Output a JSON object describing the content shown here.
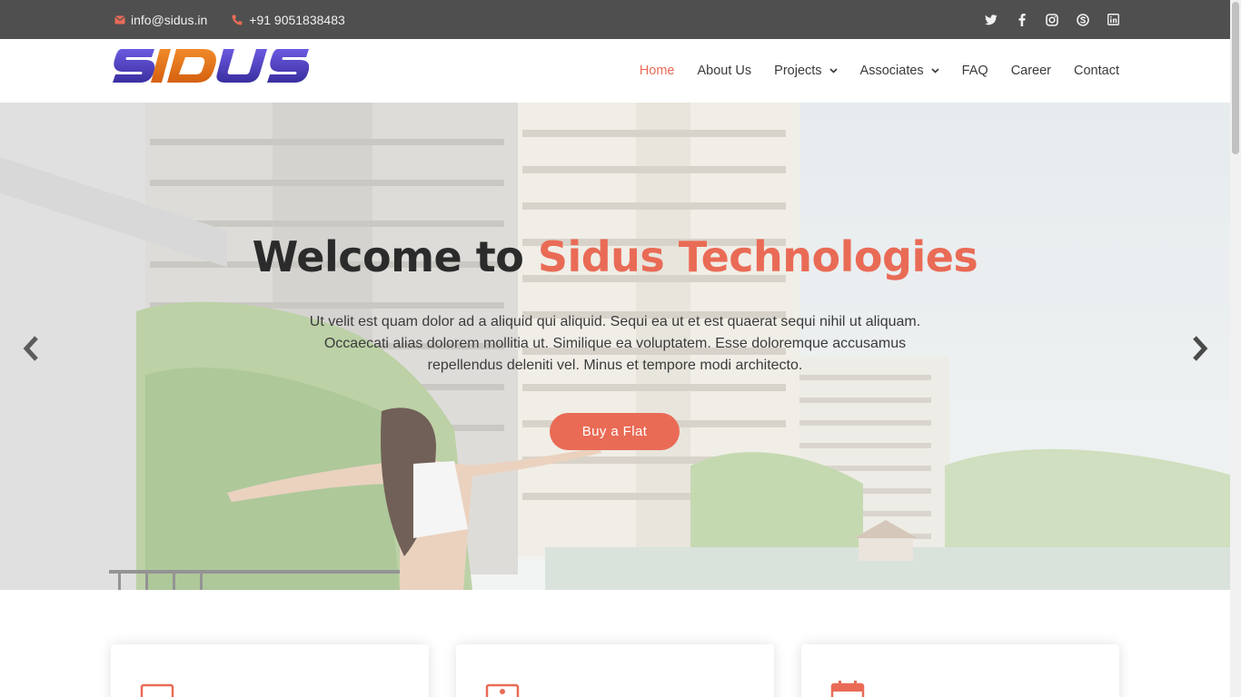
{
  "topbar": {
    "email": "info@sidus.in",
    "phone": "+91 9051838483",
    "social_icons": [
      "twitter-icon",
      "facebook-icon",
      "instagram-icon",
      "skype-icon",
      "linkedin-icon"
    ]
  },
  "header": {
    "logo_text": "SIDUS",
    "nav": [
      {
        "label": "Home",
        "active": true
      },
      {
        "label": "About Us"
      },
      {
        "label": "Projects",
        "dropdown": true
      },
      {
        "label": "Associates",
        "dropdown": true
      },
      {
        "label": "FAQ"
      },
      {
        "label": "Career"
      },
      {
        "label": "Contact"
      }
    ]
  },
  "hero": {
    "title_prefix": "Welcome to ",
    "title_accent": "Sidus Technologies",
    "text": "Ut velit est quam dolor ad a aliquid qui aliquid. Sequi ea ut et est quaerat sequi nihil ut aliquam. Occaecati alias dolorem mollitia ut. Similique ea voluptatem. Esse doloremque accusamus repellendus deleniti vel. Minus et tempore modi architecto.",
    "button_label": "Buy a Flat"
  },
  "cards": {
    "icons": [
      "monitor-icon",
      "image-icon",
      "calendar-icon"
    ]
  },
  "colors": {
    "accent": "#e96b56",
    "topbar_bg": "#4f4f4f",
    "logo_purple": "#4a3fb5",
    "logo_orange": "#e8771f"
  }
}
